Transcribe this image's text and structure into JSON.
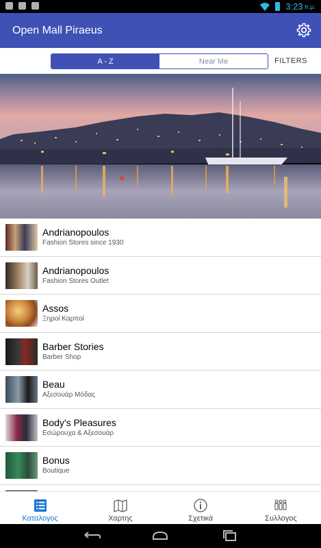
{
  "status_bar": {
    "time": "3:23",
    "ampm": "π.μ."
  },
  "app_bar": {
    "title": "Open Mall Piraeus",
    "settings_icon": "gear-icon"
  },
  "tabs": [
    {
      "label": "A - Z",
      "active": true
    },
    {
      "label": "Near Me",
      "active": false
    }
  ],
  "filters_label": "FILTERS",
  "stores": [
    {
      "name": "Andrianopoulos",
      "subtitle": "Fashion Stores since 1930"
    },
    {
      "name": "Andrianopoulos",
      "subtitle": "Fashion Stores Outlet"
    },
    {
      "name": "Assos",
      "subtitle": "Ξηροί Καρποί"
    },
    {
      "name": "Barber Stories",
      "subtitle": "Barber Shop"
    },
    {
      "name": "Beau",
      "subtitle": "Αξεσουάρ Μόδας"
    },
    {
      "name": "Body's Pleasures",
      "subtitle": "Εσώρουχα & Αξεσουάρ"
    },
    {
      "name": "Bonus",
      "subtitle": "Boutique"
    }
  ],
  "bottom_nav": [
    {
      "label": "Καταλογος",
      "icon": "list-icon",
      "active": true
    },
    {
      "label": "Χαρτης",
      "icon": "map-icon",
      "active": false
    },
    {
      "label": "Σχετικά",
      "icon": "info-icon",
      "active": false
    },
    {
      "label": "Συλλογος",
      "icon": "people-icon",
      "active": false
    }
  ],
  "colors": {
    "primary": "#3f51b5",
    "accent": "#1976d2",
    "status_icons": "#33b5e5"
  }
}
